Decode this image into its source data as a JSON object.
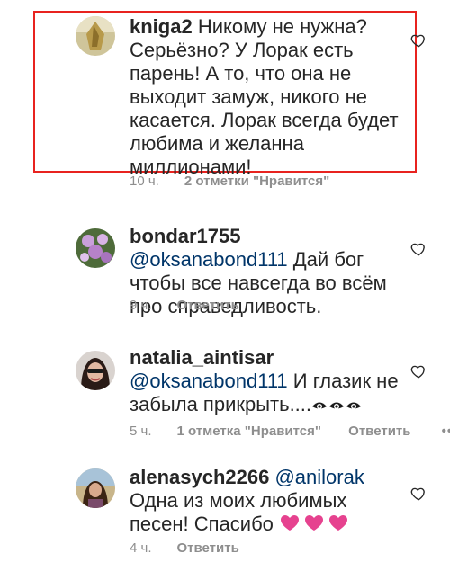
{
  "colors": {
    "highlight_border": "#e8231f",
    "mention": "#003569",
    "meta": "#8e8e8e",
    "text": "#262626",
    "heart_emoji": "#e6428f"
  },
  "comments": [
    {
      "username": "kniga2",
      "text": "Никому не нужна? Серьёзно? У Лорак есть парень! А то, что она не выходит замуж, никого не касается. Лорак всегда будет любима и желанна миллионами!",
      "time": "10 ч.",
      "likes": "2 отметки \"Нравится\"",
      "highlighted": true,
      "icon": "heart-outline-icon"
    },
    {
      "username": "bondar1755",
      "mention": "@oksanabond111",
      "text": "Дай бог чтобы все навсегда во всём про справедливость.",
      "time": "9 ч.",
      "reply": "Ответить",
      "icon": "heart-outline-icon"
    },
    {
      "username": "natalia_aintisar",
      "mention": "@oksanabond111",
      "text": "И глазик не забыла прикрыть....",
      "emoji": "see-no-evil-eyes-icon",
      "time": "5 ч.",
      "likes": "1 отметка \"Нравится\"",
      "reply": "Ответить",
      "more": "•••",
      "icon": "heart-outline-icon"
    },
    {
      "username": "alenasych2266",
      "mention": "@anilorak",
      "text": "Одна из моих любимых песен! Спасибо",
      "emoji": "pink-hearts-icon",
      "time": "4 ч.",
      "reply": "Ответить",
      "icon": "heart-outline-icon"
    }
  ]
}
